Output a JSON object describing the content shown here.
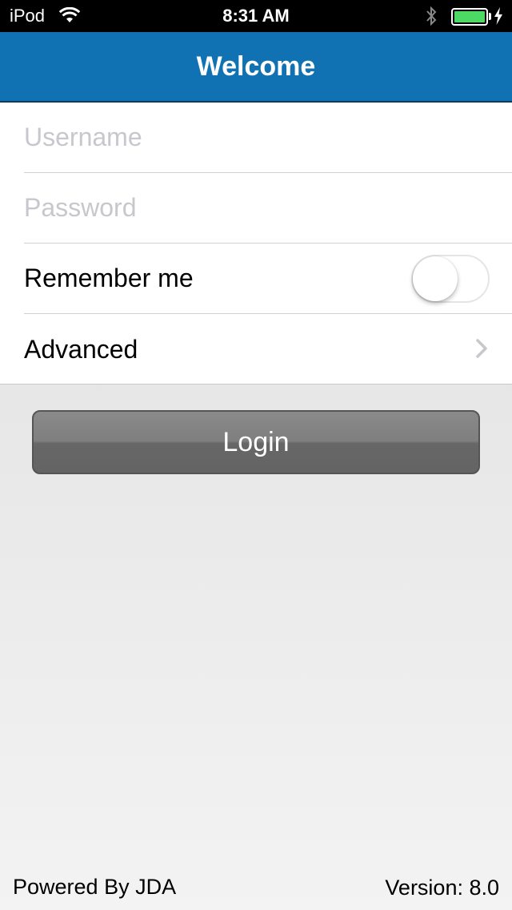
{
  "status_bar": {
    "carrier": "iPod",
    "time": "8:31 AM",
    "icons": [
      "wifi-icon",
      "bluetooth-icon",
      "battery-icon",
      "charging-icon"
    ],
    "battery_color": "#4cd964"
  },
  "nav": {
    "title": "Welcome",
    "background": "#1072b2"
  },
  "form": {
    "username": {
      "placeholder": "Username",
      "value": ""
    },
    "password": {
      "placeholder": "Password",
      "value": ""
    },
    "remember_me": {
      "label": "Remember me",
      "on": false
    },
    "advanced": {
      "label": "Advanced",
      "icon": "chevron-right-icon"
    }
  },
  "login": {
    "label": "Login"
  },
  "footer": {
    "powered_by": "Powered By JDA",
    "version": "Version: 8.0"
  }
}
